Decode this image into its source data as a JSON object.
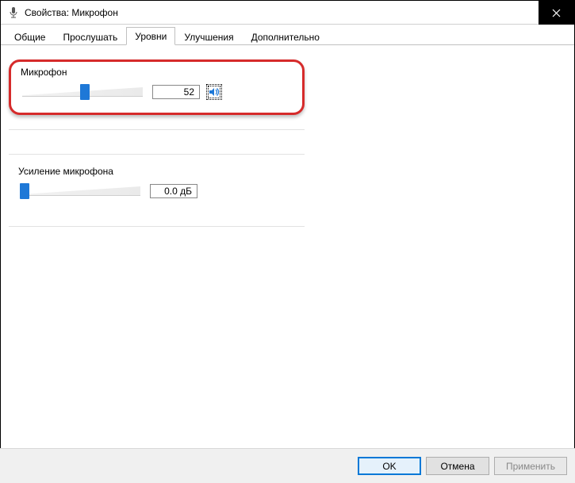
{
  "window": {
    "title": "Свойства: Микрофон"
  },
  "tabs": {
    "general": "Общие",
    "listen": "Прослушать",
    "levels": "Уровни",
    "enhance": "Улучшения",
    "advanced": "Дополнительно"
  },
  "mic": {
    "label": "Микрофон",
    "value": "52",
    "slider_percent": 52
  },
  "boost": {
    "label": "Усиление микрофона",
    "value": "0.0 дБ",
    "slider_percent": 0
  },
  "buttons": {
    "ok": "OK",
    "cancel": "Отмена",
    "apply": "Применить"
  }
}
